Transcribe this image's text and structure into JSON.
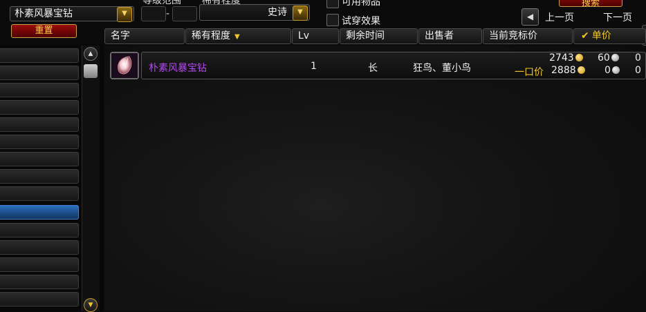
{
  "search": {
    "item_name_value": "朴素风暴宝钻",
    "reset_label": "重置",
    "level_range_label": "等级范围",
    "level_separator": "-",
    "rarity_label": "稀有程度",
    "rarity_value": "史诗",
    "usable_items_label": "可用物品",
    "tryon_label": "试穿效果",
    "search_button_label": "搜索"
  },
  "pager": {
    "prev_label": "上一页",
    "next_label": "下一页"
  },
  "columns": {
    "name": "名字",
    "rarity": "稀有程度",
    "level": "Lv",
    "time_left": "剩余时间",
    "seller": "出售者",
    "current_bid": "当前竞标价",
    "unit_price": "单价"
  },
  "listings": [
    {
      "name": "朴素风暴宝钻",
      "level": "1",
      "time_left": "长",
      "seller": "狂鸟、董小鸟",
      "bid_gold": "2743",
      "bid_silver": "60",
      "bid_copper": "0",
      "buyout_label": "一口价",
      "buyout_gold": "2888",
      "buyout_silver": "0",
      "buyout_copper": "0"
    }
  ],
  "icons": {
    "dropdown": "chevron-down-icon",
    "prev": "arrow-left-icon",
    "gold": "gold-coin-icon",
    "silver": "silver-coin-icon"
  },
  "colors": {
    "epic_purple": "#b349f0",
    "gold_text": "#f2c72e",
    "button_red": "#9b0b0b",
    "selected_blue": "#2c6fbf"
  }
}
